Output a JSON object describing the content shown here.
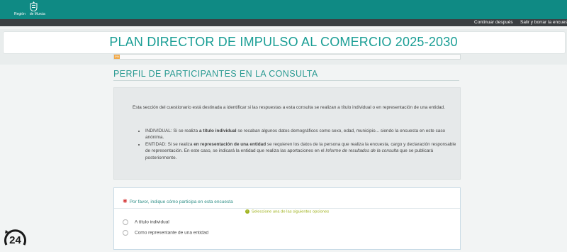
{
  "header": {
    "logo_text_1": "Región",
    "logo_text_2": "de Murcia",
    "logo_icon": "coat-of-arms-icon"
  },
  "topnav": {
    "continue_later": "Continuar después",
    "exit_delete": "Salir y borrar la encuesta"
  },
  "page": {
    "title": "PLAN DIRECTOR DE IMPULSO AL COMERCIO 2025-2030",
    "progress": {
      "percent": 0,
      "label": "0%",
      "color": "#f0a94a"
    }
  },
  "section": {
    "title": "PERFIL DE PARTICIPANTES EN LA CONSULTA",
    "intro": "Esta sección del cuestionario está destinada a identificar si las respuestas a esta consulta se realizan a título individual o en representación de una entidad.",
    "bullet1_a": "INDIVIDUAL: Si se realiza ",
    "bullet1_b": "a título individual",
    "bullet1_c": " se recaban algunos datos demográficos como sexo, edad, municipio... siendo la encuesta en este caso anónima.",
    "bullet2_a": "ENTIDAD: Si se realiza ",
    "bullet2_b": "en representación de una entidad",
    "bullet2_c": " se requieren los datos de la persona que realiza la encuesta, cargo y declaración responsable de representación. En este caso, se indicará la entidad que realiza las aportaciones en el ",
    "bullet2_d": "Informe de resultados de la consulta",
    "bullet2_e": " que se publicará posteriormente."
  },
  "question": {
    "required_mark": "✱",
    "text": "Por favor, indique cómo participa en esta encuesta",
    "help_icon": "!",
    "help": "Seleccione una de las siguientes opciones",
    "options": [
      "A título individual",
      "Como representante de una entidad"
    ]
  },
  "badge": {
    "text": "24",
    "color": "#1a1a1a"
  }
}
